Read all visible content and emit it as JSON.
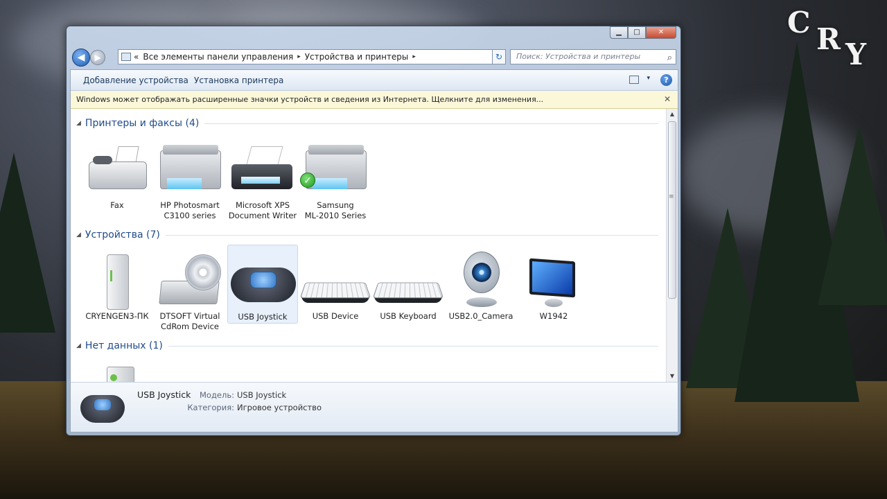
{
  "desktop": {
    "logo_letters": [
      "C",
      "R",
      "Y"
    ]
  },
  "window": {
    "captions": {
      "minimize": "▁",
      "maximize": "□",
      "close": "✕"
    },
    "address": {
      "back": "◀",
      "forward": "▶",
      "crumbs": [
        "Все элементы панели управления",
        "Устройства и принтеры"
      ],
      "sep": "▸",
      "dropdown": "▾",
      "refresh": "↻",
      "lead": "«"
    },
    "search": {
      "placeholder": "Поиск: Устройства и принтеры",
      "icon": "⌕"
    },
    "commandbar": {
      "add_device": "Добавление устройства",
      "add_printer": "Установка принтера",
      "views_dd": "▾",
      "help": "?"
    },
    "infobar": {
      "text": "Windows может отображать расширенные значки устройств и сведения из Интернета.  Щелкните для изменения...",
      "close": "✕"
    },
    "groups": [
      {
        "title": "Принтеры и факсы (4)",
        "items": [
          {
            "icon": "fax-icon",
            "label": "Fax"
          },
          {
            "icon": "printer-icon",
            "label": "HP Photosmart\nC3100 series"
          },
          {
            "icon": "xps-printer-icon",
            "label": "Microsoft XPS\nDocument Writer"
          },
          {
            "icon": "printer-default-icon",
            "label": "Samsung\nML-2010 Series"
          }
        ]
      },
      {
        "title": "Устройства (7)",
        "items": [
          {
            "icon": "computer-icon",
            "label": "CRYENGEN3-ПК"
          },
          {
            "icon": "dvd-drive-icon",
            "label": "DTSOFT Virtual\nCdRom Device"
          },
          {
            "icon": "gamepad-icon",
            "label": "USB  Joystick",
            "selected": true
          },
          {
            "icon": "keyboard-icon",
            "label": "USB Device"
          },
          {
            "icon": "keyboard-icon",
            "label": "USB Keyboard"
          },
          {
            "icon": "webcam-icon",
            "label": "USB2.0_Camera"
          },
          {
            "icon": "monitor-icon",
            "label": "W1942"
          }
        ]
      },
      {
        "title": "Нет данных (1)",
        "items": [
          {
            "icon": "unknown-device-icon",
            "label": ""
          }
        ]
      }
    ],
    "group_triangle": "◢",
    "scrollbar": {
      "up": "▲",
      "down": "▼",
      "grip": "≡"
    },
    "details": {
      "name": "USB  Joystick",
      "model_label": "Модель:",
      "model_value": "USB  Joystick",
      "category_label": "Категория:",
      "category_value": "Игровое устройство"
    }
  }
}
